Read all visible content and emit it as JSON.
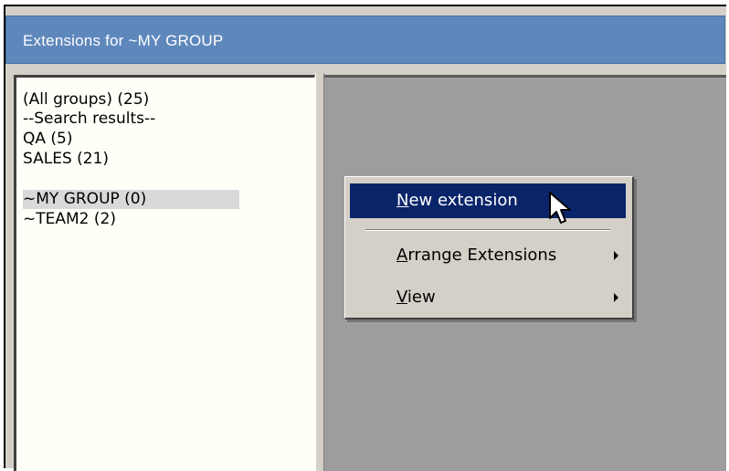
{
  "window": {
    "title": "Extensions for ~MY GROUP"
  },
  "groups": [
    {
      "label": "(All groups) (25)",
      "selected": false
    },
    {
      "label": "--Search results--",
      "selected": false
    },
    {
      "label": "QA (5)",
      "selected": false
    },
    {
      "label": "SALES (21)",
      "selected": false
    },
    {
      "label": "~MY GROUP (0)",
      "selected": true
    },
    {
      "label": "~TEAM2 (2)",
      "selected": false
    }
  ],
  "context_menu": {
    "items": [
      {
        "mnemonic": "N",
        "rest": "ew extension",
        "highlighted": true,
        "submenu": false
      },
      {
        "mnemonic": "A",
        "rest": "rrange Extensions",
        "highlighted": false,
        "submenu": true
      },
      {
        "mnemonic": "V",
        "rest": "iew",
        "highlighted": false,
        "submenu": true
      }
    ]
  },
  "colors": {
    "titlebar": "#5e87bc",
    "menu_highlight": "#0a246a",
    "pane_background": "#9d9d9d",
    "selected_group": "#d9d9d9"
  }
}
